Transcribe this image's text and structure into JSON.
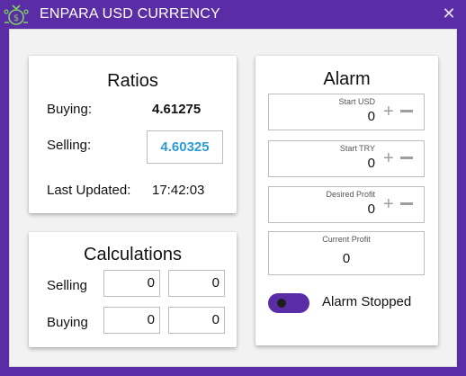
{
  "window": {
    "title": "ENPARA USD CURRENCY",
    "close_glyph": "✕",
    "app_icon": "money-bag-icon",
    "accent": "#5a2ca6"
  },
  "ratios": {
    "title": "Ratios",
    "buying_label": "Buying:",
    "buying_value": "4.61275",
    "selling_label": "Selling:",
    "selling_value": "4.60325",
    "selling_color": "#2c9bd6",
    "updated_label": "Last Updated:",
    "updated_value": "17:42:03"
  },
  "calculations": {
    "title": "Calculations",
    "selling_label": "Selling",
    "buying_label": "Buying",
    "selling_values": [
      "0",
      "0"
    ],
    "buying_values": [
      "0",
      "0"
    ]
  },
  "alarm": {
    "title": "Alarm",
    "start_usd_label": "Start USD",
    "start_usd_value": "0",
    "start_try_label": "Start TRY",
    "start_try_value": "0",
    "desired_profit_label": "Desired Profit",
    "desired_profit_value": "0",
    "current_profit_label": "Current Profit",
    "current_profit_value": "0",
    "plus_glyph": "+",
    "toggle_label": "Alarm Stopped",
    "toggle_on": false
  }
}
